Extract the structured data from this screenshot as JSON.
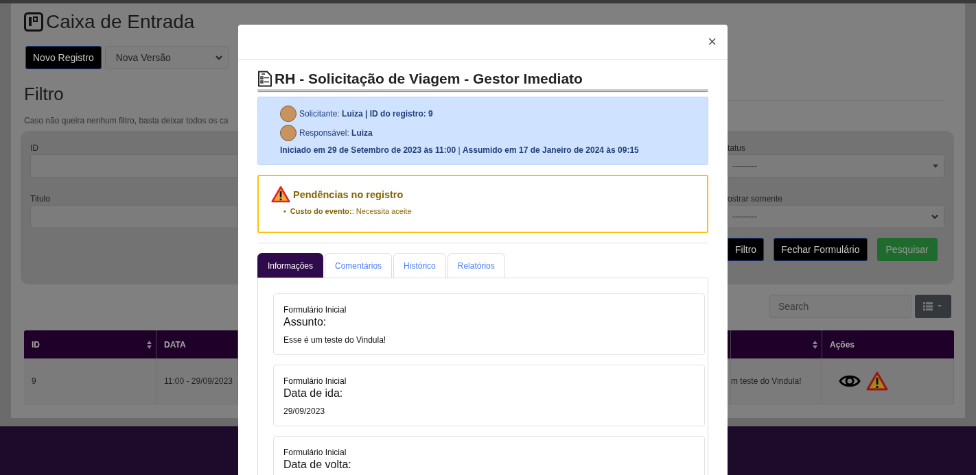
{
  "page": {
    "title": "Caixa de Entrada",
    "new_button": "Novo Registro",
    "version_select": {
      "value": "Nova Versão"
    },
    "filter_heading": "Filtro",
    "filter_hint": "Caso não queira nenhum filtro, basta deixar todos os ca"
  },
  "filter": {
    "fields": [
      {
        "label": "ID"
      },
      {
        "label": "Titulo"
      }
    ],
    "right_fields": [
      {
        "label": "tatus",
        "value": "---------",
        "kind": "small-caret"
      },
      {
        "label": "ostrar somente",
        "value": "---------",
        "kind": "chevron"
      }
    ],
    "buttons": [
      {
        "label": "Filtro",
        "kind": "dark"
      },
      {
        "label": "Fechar Formulário",
        "kind": "dark"
      },
      {
        "label": "Pesquisar",
        "kind": "success"
      }
    ]
  },
  "toolbar": {
    "search": {
      "placeholder": "Search"
    }
  },
  "table": {
    "columns": [
      {
        "label": "ID",
        "sortable": true
      },
      {
        "label": "DATA",
        "sortable": false
      }
    ],
    "column_3": {
      "sortable": true
    },
    "column_4": {
      "label": "Ações"
    },
    "rows": [
      {
        "cells": [
          "9",
          "11:00 - 29/09/2023"
        ],
        "column_3": "m teste do Vindula!",
        "pending": true
      }
    ]
  },
  "modal": {
    "close": "×",
    "title": "RH - Solicitação de Viagem - Gestor Imediato",
    "info": {
      "requester_line": "Solicitante: **Luiza | ID do registro: 9**",
      "responsible_line": "Responsável: **Luiza**",
      "dates_line": "**Iniciado em 29 de Setembro de 2023 às 11:00** | **Assumido em 17 de Janeiro de 2024 às 09:15**"
    },
    "pending": {
      "title": "Pendências no registro",
      "marker": "•",
      "items": [
        "**Custo do evento:**: Necessita aceite"
      ]
    },
    "tabs": [
      {
        "label": "Informações",
        "selected": true
      },
      {
        "label": "Comentários",
        "selected": false
      },
      {
        "label": "Histórico",
        "selected": false
      },
      {
        "label": "Relatórios",
        "selected": false
      }
    ],
    "fields": [
      {
        "section": "Formulário Inicial",
        "label": "Assunto:",
        "value": "Esse é um teste do Vindula!"
      },
      {
        "section": "Formulário Inicial",
        "label": "Data de ida:",
        "value": "29/09/2023"
      },
      {
        "section": "Formulário Inicial",
        "label": "Data de volta:"
      }
    ]
  }
}
